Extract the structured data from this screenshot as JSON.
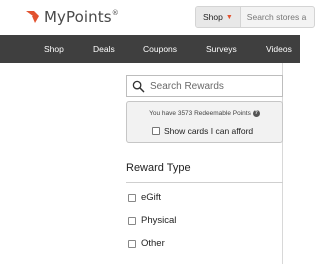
{
  "header": {
    "logo_text": "MyPoints",
    "logo_mark": "®",
    "search_scope": "Shop",
    "search_placeholder": "Search stores a"
  },
  "nav": {
    "items": [
      "Shop",
      "Deals",
      "Coupons",
      "Surveys",
      "Videos"
    ]
  },
  "sidebar": {
    "search_placeholder": "Search Rewards",
    "points_text": "You have 3573 Redeemable Points",
    "afford_label": "Show cards I can afford",
    "reward_type_title": "Reward Type",
    "filters": [
      "eGift",
      "Physical",
      "Other"
    ]
  },
  "colors": {
    "brand_orange": "#e2522f",
    "nav_bg": "#3f3f3f"
  },
  "icons": {
    "logo": "mypoints-logo-icon",
    "search": "search-icon",
    "help": "help-icon",
    "caret": "chevron-down-icon"
  }
}
